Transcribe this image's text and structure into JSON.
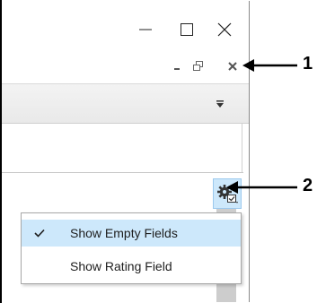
{
  "window": {
    "caption_buttons": [
      {
        "name": "minimize-icon"
      },
      {
        "name": "maximize-icon"
      },
      {
        "name": "close-icon"
      }
    ],
    "mdi_buttons": [
      {
        "name": "mdi-minimize-icon"
      },
      {
        "name": "mdi-restore-icon"
      },
      {
        "name": "mdi-close-icon"
      }
    ]
  },
  "toolbar": {
    "gear_icon": "gear-options-icon",
    "band_icon": "customize-arrow-icon"
  },
  "menu": {
    "items": [
      {
        "label": "Show Empty Fields",
        "checked": true
      },
      {
        "label": "Show Rating Field",
        "checked": false
      }
    ]
  },
  "annotations": {
    "callout_1": "1",
    "callout_2": "2"
  },
  "colors": {
    "highlight": "#cde8fb",
    "highlight_border": "#9cc9ee",
    "scroll_thumb": "#cdcdcd"
  }
}
